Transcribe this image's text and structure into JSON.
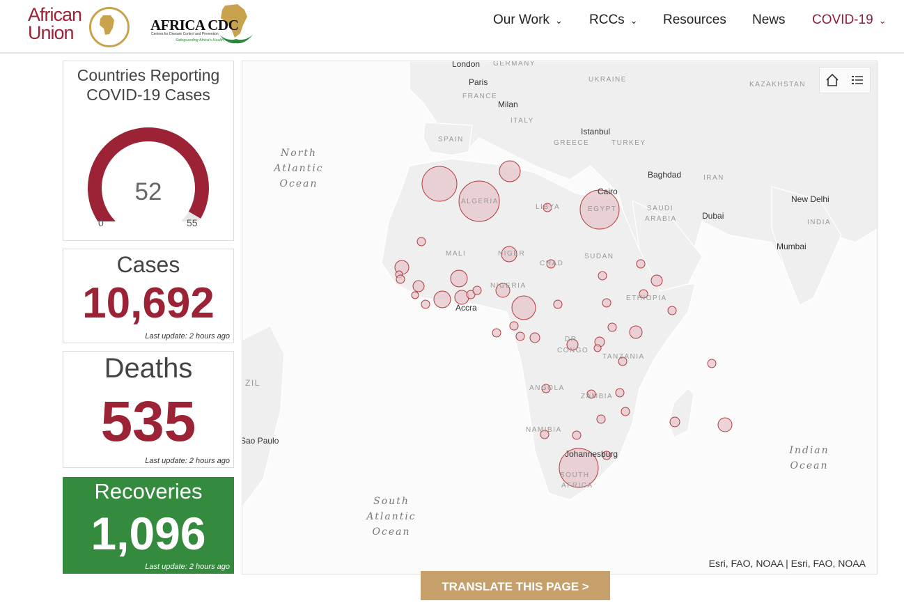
{
  "header": {
    "au_logo_text": [
      "African",
      "Union"
    ],
    "cdc_title": "AFRICA CDC",
    "cdc_subtitle": "Centres for Disease Control and Prevention",
    "cdc_tagline": "Safeguarding Africa's Health",
    "nav": [
      {
        "label": "Our Work",
        "dropdown": true
      },
      {
        "label": "RCCs",
        "dropdown": true
      },
      {
        "label": "Resources",
        "dropdown": false
      },
      {
        "label": "News",
        "dropdown": false
      },
      {
        "label": "COVID-19",
        "dropdown": true,
        "active": true
      }
    ]
  },
  "gauge": {
    "title_line1": "Countries Reporting",
    "title_line2": "COVID-19 Cases",
    "value": 52,
    "min": 0,
    "max": 55,
    "color": "#9b2335"
  },
  "cases": {
    "label": "Cases",
    "value": "10,692",
    "update": "Last update: 2 hours ago"
  },
  "deaths": {
    "label": "Deaths",
    "value": "535",
    "update": "Last update: 2 hours ago"
  },
  "recoveries": {
    "label": "Recoveries",
    "value": "1,096",
    "update": "Last update: 2 hours ago",
    "color": "#348b3e"
  },
  "map": {
    "cities": [
      "London",
      "Paris",
      "Milan",
      "Istanbul",
      "Baghdad",
      "Cairo",
      "Dubai",
      "New Delhi",
      "Mumbai",
      "Accra",
      "Johannesburg",
      "Sao Paulo"
    ],
    "countries": [
      "GERMANY",
      "UKRAINE",
      "KAZAKHSTAN",
      "FRANCE",
      "ITALY",
      "SPAIN",
      "GREECE",
      "TURKEY",
      "IRAN",
      "ALGERIA",
      "LIBYA",
      "EGYPT",
      "SAUDI",
      "ARABIA",
      "INDIA",
      "MALI",
      "NIGER",
      "CHAD",
      "SUDAN",
      "NIGERIA",
      "ETHIOPIA",
      "DR",
      "CONGO",
      "TANZANIA",
      "ANGOLA",
      "ZAMBIA",
      "NAMIBIA",
      "SOUTH",
      "AFRICA",
      "ZIL"
    ],
    "oceans": [
      "North\nAtlantic\nOcean",
      "South\nAtlantic\nOcean",
      "Indian\nOcean"
    ],
    "attribution": "Esri, FAO, NOAA | Esri, FAO, NOAA",
    "tools": [
      "home-icon",
      "list-icon"
    ]
  },
  "translate_button": "TRANSLATE THIS PAGE >",
  "colors": {
    "brand": "#9b2335",
    "bubble_fill": "#e6c6cc",
    "bubble_stroke": "#b03a3a"
  }
}
